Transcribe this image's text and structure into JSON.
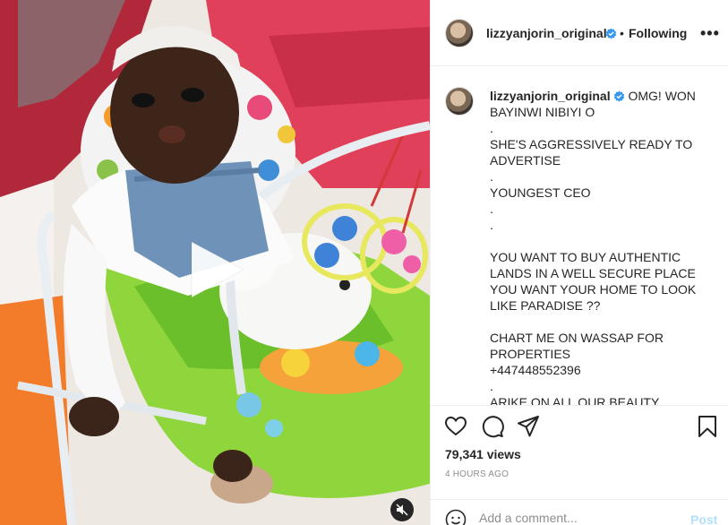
{
  "post": {
    "username": "lizzyanjorin_original",
    "follow_state": "Following",
    "separator": "•",
    "more_label": "•••"
  },
  "caption": {
    "username": "lizzyanjorin_original",
    "lines": [
      "OMG! WON BAYINWI NIBIYI O",
      ".",
      "SHE'S AGGRESSIVELY READY TO ADVERTISE",
      ".",
      "YOUNGEST CEO",
      ".",
      ".",
      "",
      "YOU WANT TO BUY AUTHENTIC LANDS IN A WELL SECURE PLACE YOU WANT YOUR HOME TO LOOK LIKE PARADISE ??",
      "",
      "CHART ME ON WASSAP FOR PROPERTIES",
      "+447448552396",
      ".",
      "ARIKE ON ALL OUR BEAUTY"
    ]
  },
  "stats": {
    "views": "79,341 views",
    "time": "4 HOURS AGO"
  },
  "comment": {
    "placeholder": "Add a comment...",
    "post_label": "Post"
  },
  "icons": {
    "verified": "verified-badge-icon",
    "play": "play-icon",
    "mute": "speaker-muted-icon",
    "like": "heart-icon",
    "comment": "comment-bubble-icon",
    "share": "paper-plane-icon",
    "save": "bookmark-icon",
    "emoji": "smiley-icon"
  },
  "colors": {
    "verified": "#3897f0",
    "post_disabled": "#b2dffc",
    "muted_text": "#8e8e8e"
  }
}
